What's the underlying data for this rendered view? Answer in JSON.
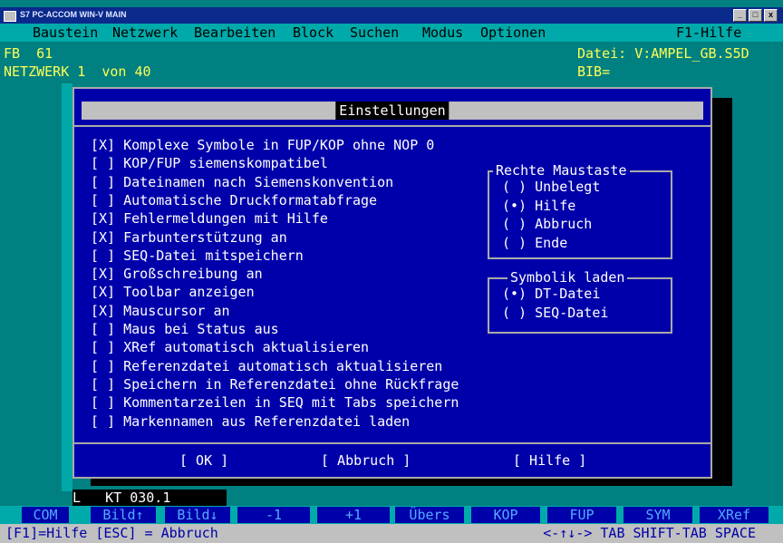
{
  "window": {
    "title": "S7 PC-ACCOM WIN-V MAIN",
    "controls": [
      "_",
      "□",
      "x"
    ]
  },
  "menu": {
    "items": [
      "Baustein",
      "Netzwerk",
      "Bearbeiten",
      "Block",
      "Suchen",
      "Modus",
      "Optionen"
    ],
    "help": "F1-Hilfe"
  },
  "header": {
    "fb": "FB  61",
    "datei": "Datei: V:AMPEL_GB.S5D",
    "netzwerk": "NETZWERK 1  von 40",
    "bib": "BIB="
  },
  "dialog": {
    "title": "Einstellungen",
    "options": [
      {
        "mark": "[X]",
        "label": "Komplexe Symbole in FUP/KOP ohne NOP 0"
      },
      {
        "mark": "[ ]",
        "label": "KOP/FUP siemenskompatibel"
      },
      {
        "mark": "[ ]",
        "label": "Dateinamen nach Siemenskonvention"
      },
      {
        "mark": "[ ]",
        "label": "Automatische Druckformatabfrage"
      },
      {
        "mark": "[X]",
        "label": "Fehlermeldungen mit Hilfe"
      },
      {
        "mark": "[X]",
        "label": "Farbunterstützung an"
      },
      {
        "mark": "[ ]",
        "label": "SEQ-Datei mitspeichern"
      },
      {
        "mark": "[X]",
        "label": "Großschreibung an"
      },
      {
        "mark": "[X]",
        "label": "Toolbar anzeigen"
      },
      {
        "mark": "[X]",
        "label": "Mauscursor an"
      },
      {
        "mark": "[ ]",
        "label": "Maus bei Status aus"
      },
      {
        "mark": "[ ]",
        "label": "XRef automatisch aktualisieren"
      },
      {
        "mark": "[ ]",
        "label": "Referenzdatei automatisch aktualisieren"
      },
      {
        "mark": "[ ]",
        "label": "Speichern in Referenzdatei ohne Rückfrage"
      },
      {
        "mark": "[ ]",
        "label": "Kommentarzeilen in SEQ mit Tabs speichern"
      },
      {
        "mark": "[ ]",
        "label": "Markennamen aus Referenzdatei laden"
      }
    ],
    "right_mouse": {
      "label": "Rechte Maustaste",
      "options": [
        {
          "mark": "( )",
          "label": "Unbelegt"
        },
        {
          "mark": "(•)",
          "label": "Hilfe"
        },
        {
          "mark": "( )",
          "label": "Abbruch"
        },
        {
          "mark": "( )",
          "label": "Ende"
        }
      ]
    },
    "symbolik": {
      "label": "Symbolik laden",
      "options": [
        {
          "mark": "(•)",
          "label": "DT-Datei"
        },
        {
          "mark": "( )",
          "label": "SEQ-Datei"
        }
      ]
    },
    "buttons": {
      "ok": "[ OK ]",
      "cancel": "[ Abbruch ]",
      "help": "[ Hilfe ]"
    }
  },
  "kt_line": "L   KT 030.1",
  "fkeys": [
    "COM",
    "Bild↑",
    "Bild↓",
    "-1",
    "+1",
    "Übers",
    "KOP",
    "FUP",
    "SYM",
    "XRef"
  ],
  "status": {
    "left": "[F1]=Hilfe [ESC] = Abbruch",
    "right": "<-↑↓-> TAB SHIFT-TAB SPACE"
  }
}
